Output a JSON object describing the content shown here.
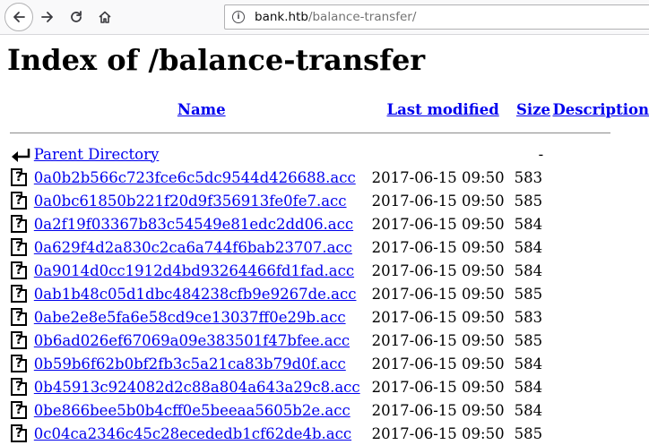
{
  "browser": {
    "url_host": "bank.htb",
    "url_path": "/balance-transfer/",
    "info_glyph": "i"
  },
  "page": {
    "title": "Index of /balance-transfer",
    "columns": {
      "name": "Name",
      "last_modified": "Last modified",
      "size": "Size",
      "description": "Description"
    },
    "parent": {
      "name": "Parent Directory",
      "size": "-"
    },
    "files": [
      {
        "name": "0a0b2b566c723fce6c5dc9544d426688.acc",
        "modified": "2017-06-15 09:50",
        "size": "583"
      },
      {
        "name": "0a0bc61850b221f20d9f356913fe0fe7.acc",
        "modified": "2017-06-15 09:50",
        "size": "585"
      },
      {
        "name": "0a2f19f03367b83c54549e81edc2dd06.acc",
        "modified": "2017-06-15 09:50",
        "size": "584"
      },
      {
        "name": "0a629f4d2a830c2ca6a744f6bab23707.acc",
        "modified": "2017-06-15 09:50",
        "size": "584"
      },
      {
        "name": "0a9014d0cc1912d4bd93264466fd1fad.acc",
        "modified": "2017-06-15 09:50",
        "size": "584"
      },
      {
        "name": "0ab1b48c05d1dbc484238cfb9e9267de.acc",
        "modified": "2017-06-15 09:50",
        "size": "585"
      },
      {
        "name": "0abe2e8e5fa6e58cd9ce13037ff0e29b.acc",
        "modified": "2017-06-15 09:50",
        "size": "583"
      },
      {
        "name": "0b6ad026ef67069a09e383501f47bfee.acc",
        "modified": "2017-06-15 09:50",
        "size": "585"
      },
      {
        "name": "0b59b6f62b0bf2fb3c5a21ca83b79d0f.acc",
        "modified": "2017-06-15 09:50",
        "size": "584"
      },
      {
        "name": "0b45913c924082d2c88a804a643a29c8.acc",
        "modified": "2017-06-15 09:50",
        "size": "584"
      },
      {
        "name": "0be866bee5b0b4cff0e5beeaa5605b2e.acc",
        "modified": "2017-06-15 09:50",
        "size": "584"
      },
      {
        "name": "0c04ca2346c45c28ecededb1cf62de4b.acc",
        "modified": "2017-06-15 09:50",
        "size": "585"
      }
    ],
    "file_icon_glyph": "?"
  }
}
